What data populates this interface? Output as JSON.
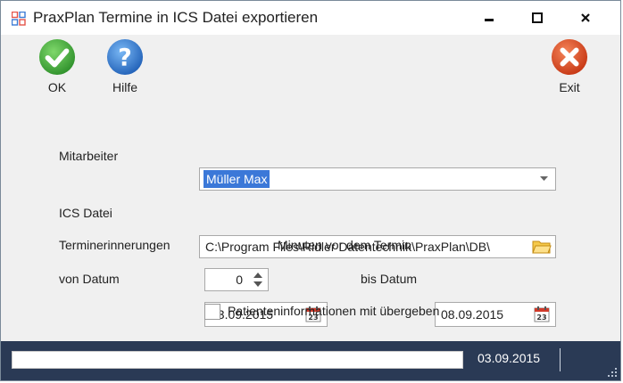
{
  "window": {
    "title": "PraxPlan Termine in ICS Datei exportieren"
  },
  "toolbar": {
    "ok_label": "OK",
    "help_label": "Hilfe",
    "exit_label": "Exit"
  },
  "form": {
    "mitarbeiter_label": "Mitarbeiter",
    "mitarbeiter_value": "Müller Max",
    "ics_label": "ICS Datei",
    "ics_value": "C:\\Program Files\\Ridler Datentechnik\\PraxPlan\\DB\\",
    "reminder_label": "Terminerinnerungen",
    "reminder_value": "0",
    "reminder_suffix": "Minuten vor dem Termin",
    "von_label": "von Datum",
    "von_value": "03.09.2015",
    "bis_label": "bis Datum",
    "bis_value": "08.09.2015",
    "calendar_day": "23",
    "checkbox_label": "Patienteninformationen mit übergeben",
    "checkbox_checked": false
  },
  "status": {
    "date": "03.09.2015",
    "progress": 0
  },
  "colors": {
    "ok": "#3aa835",
    "help": "#2f7fd6",
    "exit": "#dc4a1e",
    "statusbar": "#2a3a55",
    "selection": "#3b78d8"
  },
  "icons": {
    "app": "grid-icon",
    "ok": "checkmark-icon",
    "help": "question-icon",
    "exit": "close-icon",
    "folder": "folder-icon",
    "calendar": "calendar-icon"
  }
}
